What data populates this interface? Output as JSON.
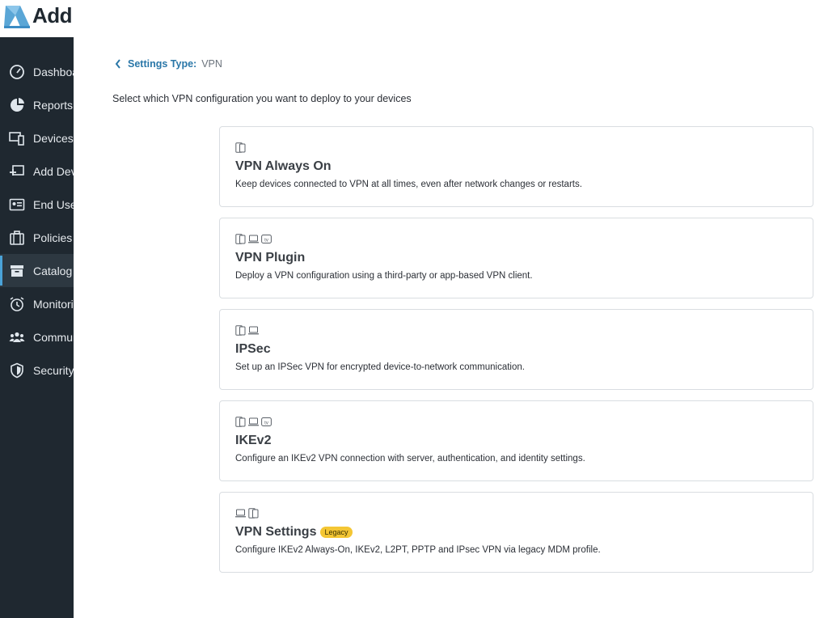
{
  "brand": {
    "name": "Add"
  },
  "sidebar": {
    "items": [
      {
        "label": "Dashboard",
        "icon": "gauge-icon"
      },
      {
        "label": "Reports",
        "icon": "pie-chart-icon"
      },
      {
        "label": "Devices",
        "icon": "devices-icon"
      },
      {
        "label": "Add Devices",
        "icon": "add-device-icon"
      },
      {
        "label": "End Users",
        "icon": "id-card-icon"
      },
      {
        "label": "Policies",
        "icon": "briefcase-icon"
      },
      {
        "label": "Catalog",
        "icon": "catalog-box-icon"
      },
      {
        "label": "Monitoring",
        "icon": "alarm-clock-icon"
      },
      {
        "label": "Community",
        "icon": "people-icon"
      },
      {
        "label": "Security",
        "icon": "shield-icon"
      }
    ],
    "active_index": 6
  },
  "breadcrumb": {
    "label": "Settings Type:",
    "value": "VPN"
  },
  "intro": "Select which VPN configuration you want to deploy to your devices",
  "options": [
    {
      "title": "VPN Always On",
      "desc": "Keep devices connected to VPN at all times, even after network changes or restarts.",
      "platforms": [
        "phone"
      ]
    },
    {
      "title": "VPN Plugin",
      "desc": "Deploy a VPN configuration using a third-party or app-based VPN client.",
      "platforms": [
        "phone",
        "laptop",
        "tv"
      ]
    },
    {
      "title": "IPSec",
      "desc": "Set up an IPSec VPN for encrypted device-to-network communication.",
      "platforms": [
        "phone",
        "laptop"
      ]
    },
    {
      "title": "IKEv2",
      "desc": "Configure an IKEv2 VPN connection with server, authentication, and identity settings.",
      "platforms": [
        "phone",
        "laptop",
        "tv"
      ]
    },
    {
      "title": "VPN Settings",
      "badge": "Legacy",
      "desc": "Configure IKEv2 Always-On, IKEv2, L2PT, PPTP and IPsec VPN via legacy MDM profile.",
      "platforms": [
        "laptop",
        "phone"
      ]
    }
  ],
  "colors": {
    "sidebar": "#1f2830",
    "link": "#2a77a8",
    "badge": "#f4c634",
    "active_indicator": "#4aa3d8"
  }
}
